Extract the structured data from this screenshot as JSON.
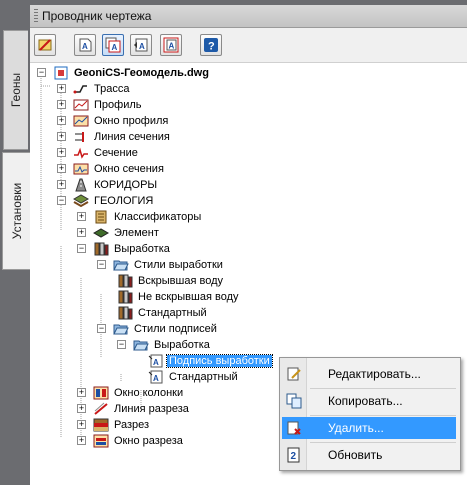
{
  "side_tabs": [
    "Геоны",
    "Установки"
  ],
  "panel_title": "Проводник чертежа",
  "toolbar_icons": [
    "pencil-cross-icon",
    "sheet-a-icon",
    "sheet-a-stack-icon",
    "sheet-a-arrow-icon",
    "sheet-a-frame-icon",
    "help-icon"
  ],
  "help_glyph": "?",
  "tree": {
    "root": "GeoniCS-Геомодель.dwg",
    "items": [
      "Трасса",
      "Профиль",
      "Окно профиля",
      "Линия сечения",
      "Сечение",
      "Окно сечения",
      "КОРИДОРЫ",
      "ГЕОЛОГИЯ",
      "Классификаторы",
      "Элемент",
      "Выработка",
      "Стили выработки",
      "Вскрывшая воду",
      "Не вскрывшая воду",
      "Стандартный",
      "Стили подписей",
      "Выработка",
      "Подпись выработки",
      "Стандартный",
      "Окно колонки",
      "Линия разреза",
      "Разрез",
      "Окно разреза"
    ]
  },
  "context_menu": [
    "Редактировать...",
    "Копировать...",
    "Удалить...",
    "Обновить"
  ],
  "colors": {
    "selection": "#3399ff",
    "panel_bg": "#6b6c70"
  }
}
